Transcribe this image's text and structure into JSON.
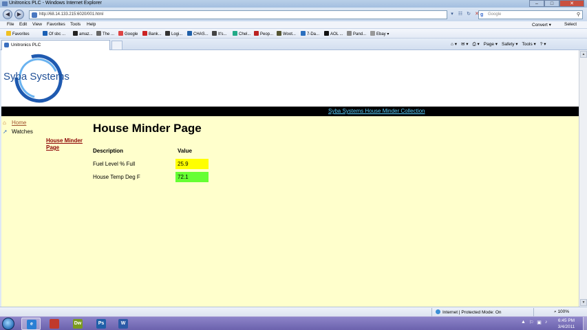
{
  "window": {
    "title": "Unitronics PLC - Windows Internet Explorer",
    "minimize": "–",
    "maximize": "□",
    "close": "✕"
  },
  "address": {
    "url": "http://68.14.133.215:6020/001.html",
    "search_placeholder": "Google",
    "search_logo": "g",
    "back_icon": "◀",
    "forward_icon": "▶",
    "tools": [
      "▾",
      "☷",
      "↻",
      "✕"
    ]
  },
  "menu": {
    "items": [
      "File",
      "Edit",
      "View",
      "Favorites",
      "Tools",
      "Help"
    ],
    "convert": "Convert ▾",
    "select": "Select"
  },
  "favorites": {
    "label": "Favorites",
    "items": [
      "Of sbc ...",
      "amaz...",
      "The ...",
      "Google",
      "Bank...",
      "Logi...",
      "CHAS...",
      "It's...",
      "Chel...",
      "Peop...",
      "Woot...",
      "7-Da...",
      "AOL ...",
      "Pand...",
      "Ebay ▾"
    ]
  },
  "tabs": {
    "active_tab": "Unitronics PLC",
    "commands": [
      "⌂ ▾",
      "✉ ▾",
      "⎙ ▾",
      "Page ▾",
      "Safety ▾",
      "Tools ▾",
      "? ▾"
    ]
  },
  "page": {
    "logo_text": "Syba Systems",
    "header_link": "Syba Systems House Minder Collection",
    "nav": {
      "home": "Home",
      "watches": "Watches",
      "sub_link": "House Minder Page"
    },
    "title": "House Minder Page",
    "table": {
      "col_description": "Description",
      "col_value": "Value",
      "rows": [
        {
          "label": "Fuel Level % Full",
          "value": "25.9",
          "color": "#ffff00"
        },
        {
          "label": "House Temp Deg F",
          "value": "72.1",
          "color": "#66ff33"
        }
      ]
    }
  },
  "status": {
    "zone": "Internet | Protected Mode: On",
    "zoom": "⌕ 100%"
  },
  "taskbar": {
    "apps": [
      {
        "name": "ie",
        "label": "e",
        "color": "#2a7fd4"
      },
      {
        "name": "firefox",
        "label": "",
        "color": "#c0392b"
      },
      {
        "name": "dreamweaver",
        "label": "Dw",
        "color": "#7a9a1f"
      },
      {
        "name": "photoshop",
        "label": "Ps",
        "color": "#1f5fa8"
      },
      {
        "name": "word",
        "label": "W",
        "color": "#2b5aa6"
      }
    ],
    "tray": [
      "▲",
      "⚐",
      "▣",
      "♪"
    ],
    "time": "6:45 PM",
    "date": "3/4/2011"
  }
}
